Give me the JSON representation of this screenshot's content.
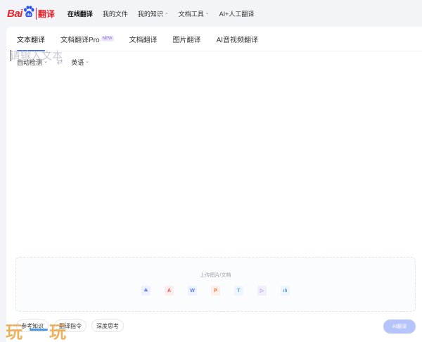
{
  "logo": {
    "part1": "Bai",
    "part2": "翻译"
  },
  "nav": [
    {
      "label": "在线翻译",
      "active": true,
      "dropdown": false
    },
    {
      "label": "我的文件",
      "active": false,
      "dropdown": false
    },
    {
      "label": "我的知识",
      "active": false,
      "dropdown": true
    },
    {
      "label": "文档工具",
      "active": false,
      "dropdown": true
    },
    {
      "label": "AI+人工翻译",
      "active": false,
      "dropdown": false
    }
  ],
  "tabs": [
    {
      "label": "文本翻译",
      "active": true
    },
    {
      "label": "文档翻译Pro",
      "badge": "NEW"
    },
    {
      "label": "文档翻译"
    },
    {
      "label": "图片翻译"
    },
    {
      "label": "AI音视频翻译"
    }
  ],
  "lang": {
    "source": "自动检测",
    "target": "英语",
    "swap": "⇄"
  },
  "input": {
    "placeholder": "请输入文本"
  },
  "upload": {
    "label": "上传图片/文档",
    "icons": [
      {
        "name": "image-file-icon",
        "glyph": "⛰",
        "color": "#6b8cf5",
        "bg": "#eef2fe"
      },
      {
        "name": "pdf-file-icon",
        "glyph": "A",
        "color": "#e54b4b",
        "bg": "#fdeeee"
      },
      {
        "name": "word-file-icon",
        "glyph": "W",
        "color": "#4e7cf2",
        "bg": "#eef2fe"
      },
      {
        "name": "ppt-file-icon",
        "glyph": "P",
        "color": "#e86a3a",
        "bg": "#fdf0ea"
      },
      {
        "name": "txt-file-icon",
        "glyph": "T",
        "color": "#4e9cf2",
        "bg": "#eef5fe"
      },
      {
        "name": "video-file-icon",
        "glyph": "▷",
        "color": "#8a6ad8",
        "bg": "#f3eefc"
      },
      {
        "name": "audio-file-icon",
        "glyph": "ılı",
        "color": "#4e9cf2",
        "bg": "#eef5fe"
      }
    ]
  },
  "bottom": {
    "chip1": "参考知识",
    "chip2": "翻译指令",
    "chip3": "深度思考",
    "ai_button": "AI翻译"
  },
  "watermark": {
    "left": "玩",
    "right": "玩"
  },
  "colors": {
    "brand_red": "#e5262e",
    "accent": "#4e6ef2"
  }
}
